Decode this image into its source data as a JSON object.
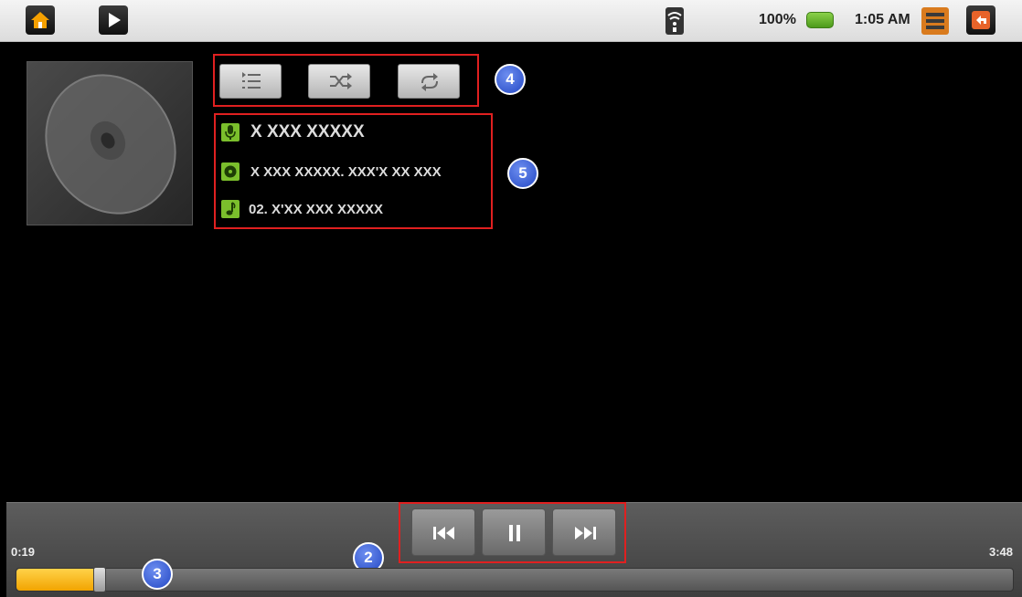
{
  "status_bar": {
    "battery": "100%",
    "time": "1:05 AM"
  },
  "callouts": {
    "toggles": "4",
    "track_info": "5",
    "transport": "2",
    "seekbar": "3"
  },
  "track_info": {
    "artist": "X XXX XXXXX",
    "album": "X XXX XXXXX. XXX'X XX XXX",
    "track": "02. X'XX XXX XXXXX"
  },
  "playback": {
    "elapsed": "0:19",
    "total": "3:48",
    "progress_fraction": 0.0833,
    "state": "playing"
  },
  "colors": {
    "accent_progress": "#f2a400",
    "info_icon_bg": "#7bbf2c",
    "callout_box": "#e02020",
    "callout_circle": "#2448c4"
  },
  "icons": {
    "status_left": [
      "home-icon",
      "play-icon"
    ],
    "status_right": [
      "wifi-icon",
      "battery-icon",
      "menu-icon",
      "back-icon"
    ],
    "toggles": [
      "queue-list-icon",
      "shuffle-icon",
      "repeat-icon"
    ],
    "info": [
      "microphone-icon",
      "disc-icon",
      "music-note-icon"
    ],
    "transport": [
      "previous-icon",
      "pause-icon",
      "next-icon"
    ]
  }
}
